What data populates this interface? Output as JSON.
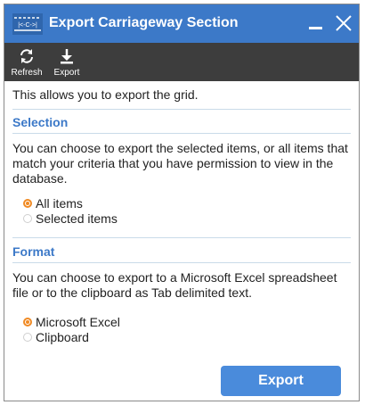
{
  "window": {
    "title": "Export Carriageway Section",
    "icon_text": "|<-C->|"
  },
  "toolbar": {
    "refresh_label": "Refresh",
    "export_label": "Export"
  },
  "content": {
    "intro": "This allows you to export the grid.",
    "selection": {
      "title": "Selection",
      "description": "You can choose to export the selected items, or all items that match your criteria that you have permission to view in the database.",
      "options": [
        {
          "label": "All items",
          "selected": true
        },
        {
          "label": "Selected items",
          "selected": false
        }
      ]
    },
    "format": {
      "title": "Format",
      "description": "You can choose to export to a Microsoft Excel spreadsheet file or to the clipboard as Tab delimited text.",
      "options": [
        {
          "label": "Microsoft Excel",
          "selected": true
        },
        {
          "label": "Clipboard",
          "selected": false
        }
      ]
    }
  },
  "footer": {
    "export_button": "Export"
  },
  "colors": {
    "titlebar": "#3c79c8",
    "toolbar": "#3d3d3d",
    "accent_radio": "#f08a24",
    "button": "#4a8bdb"
  }
}
